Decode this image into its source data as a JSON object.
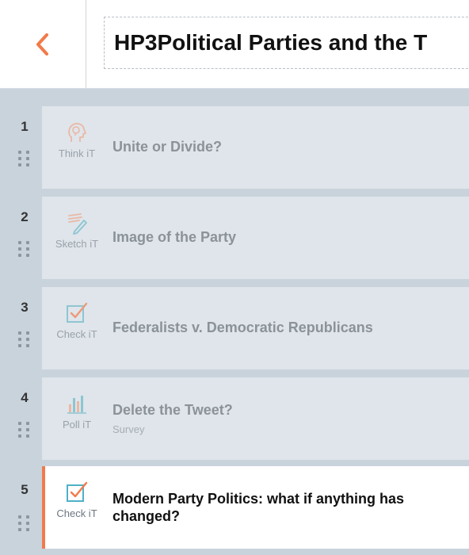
{
  "header": {
    "back_icon": "chevron-left-icon",
    "title": "HP3Political Parties and the T",
    "accent_color": "#f27a4a"
  },
  "activities": [
    {
      "number": "1",
      "type_label": "Think iT",
      "icon": "head-lightbulb-icon",
      "title": "Unite or Divide?",
      "subtitle": ""
    },
    {
      "number": "2",
      "type_label": "Sketch iT",
      "icon": "pencil-sketch-icon",
      "title": "Image of the Party",
      "subtitle": ""
    },
    {
      "number": "3",
      "type_label": "Check iT",
      "icon": "checkbox-icon",
      "title": "Federalists v. Democratic Republicans",
      "subtitle": ""
    },
    {
      "number": "4",
      "type_label": "Poll iT",
      "icon": "bar-chart-icon",
      "title": "Delete the Tweet?",
      "subtitle": "Survey"
    },
    {
      "number": "5",
      "type_label": "Check iT",
      "icon": "checkbox-icon",
      "title": "Modern Party Politics: what if anything has changed?",
      "subtitle": "",
      "selected": true
    }
  ]
}
